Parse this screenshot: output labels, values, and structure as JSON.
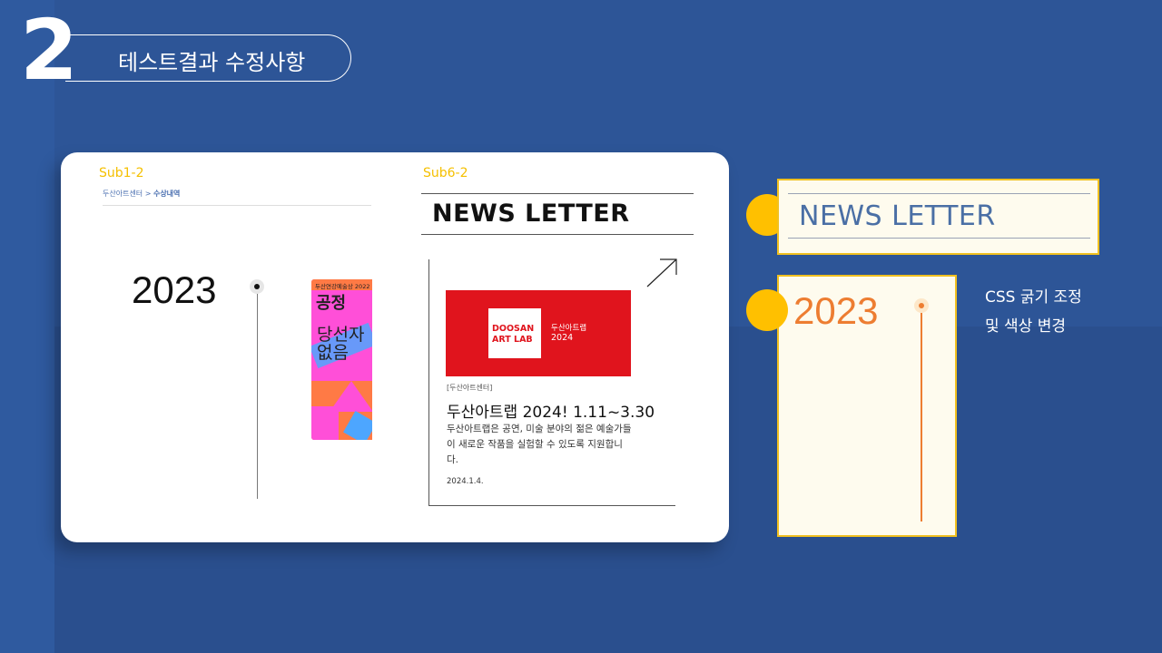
{
  "slide": {
    "number": "2",
    "title": "테스트결과 수정사항"
  },
  "card": {
    "left": {
      "label": "Sub1-2",
      "breadcrumb_home": "두산아트센터 > ",
      "breadcrumb_current": "수상내역",
      "year": "2023",
      "poster": {
        "top_text": "두산연강예술상 2022",
        "title": "공정",
        "body": "당선자 없음"
      }
    },
    "right": {
      "label": "Sub6-2",
      "newsletter_title": "NEWS LETTER",
      "news": {
        "image_logo_line1": "DOOSAN",
        "image_logo_line2": "ART LAB",
        "image_title": "두산아트랩",
        "image_year": "2024",
        "category": "[두산아트센터]",
        "headline": "두산아트랩 2024! 1.11~3.30",
        "body": "두산아트랩은 공연, 미술 분야의 젊은 예술가들이 새로운 작품을 실험할 수 있도록 지원합니다.",
        "date": "2024.1.4."
      }
    }
  },
  "revisions": {
    "newsletter_title": "NEWS LETTER",
    "year": "2023",
    "note_line1": "CSS 굵기 조정",
    "note_line2": "및 색상 변경"
  },
  "colors": {
    "background": "#2d5597",
    "accent_yellow": "#ffc000",
    "accent_orange": "#ed7d31",
    "revised_title_blue": "#4a6fa5",
    "news_image_red": "#e0141d"
  }
}
